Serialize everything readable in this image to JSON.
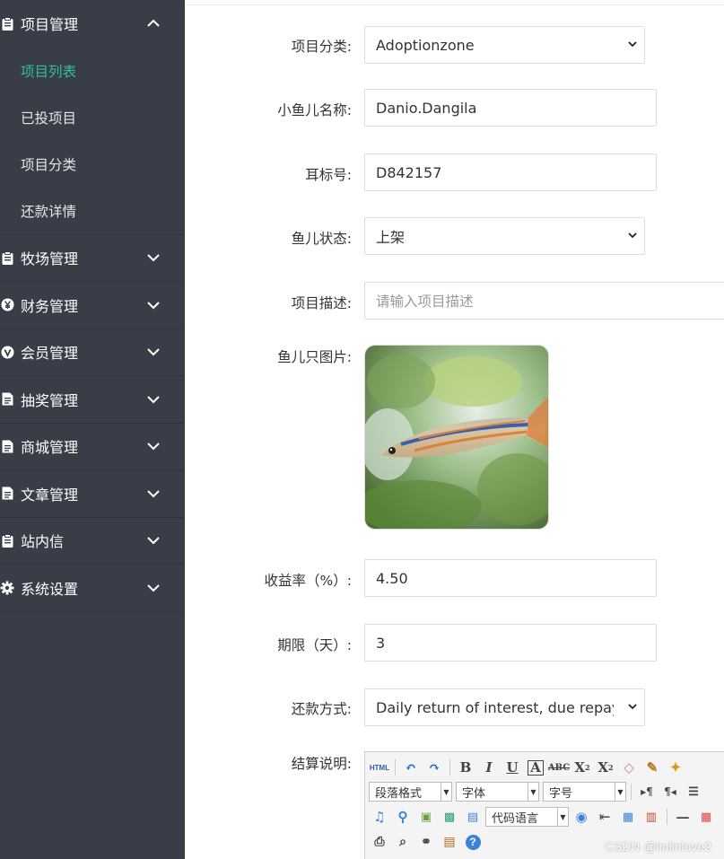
{
  "sidebar": {
    "groups": [
      {
        "label": "项目管理",
        "icon": "clipboard-icon",
        "expanded": true,
        "children": [
          "项目列表",
          "已投项目",
          "项目分类",
          "还款详情"
        ],
        "active_child": 0
      },
      {
        "label": "牧场管理",
        "icon": "clipboard-icon"
      },
      {
        "label": "财务管理",
        "icon": "yen-icon"
      },
      {
        "label": "会员管理",
        "icon": "vip-icon"
      },
      {
        "label": "抽奖管理",
        "icon": "document-icon"
      },
      {
        "label": "商城管理",
        "icon": "document-icon"
      },
      {
        "label": "文章管理",
        "icon": "document-icon"
      },
      {
        "label": "站内信",
        "icon": "clipboard-icon"
      },
      {
        "label": "系统设置",
        "icon": "gear-icon"
      }
    ],
    "colors": {
      "background": "#383d47",
      "active": "#2fbf9d"
    }
  },
  "form": {
    "category": {
      "label": "项目分类:",
      "value": "Adoptionzone"
    },
    "fish_name": {
      "label": "小鱼儿名称:",
      "value": "Danio.Dangila"
    },
    "tag_no": {
      "label": "耳标号:",
      "value": "D842157"
    },
    "status": {
      "label": "鱼儿状态:",
      "value": "上架"
    },
    "description": {
      "label": "项目描述:",
      "placeholder": "请输入项目描述"
    },
    "image": {
      "label": "鱼儿只图片:"
    },
    "yield_rate": {
      "label": "收益率（%）:",
      "value": "4.50"
    },
    "term": {
      "label": "期限（天）:",
      "value": "3"
    },
    "repayment": {
      "label": "还款方式:",
      "value": "Daily return of interest, due repayment"
    },
    "settlement": {
      "label": "结算说明:"
    }
  },
  "editor": {
    "paragraph_format": "段落格式",
    "font_family": "字体",
    "font_size": "字号",
    "code_language": "代码语言",
    "html_label": "HTML"
  },
  "watermark": "CSDN @linlinlove2"
}
